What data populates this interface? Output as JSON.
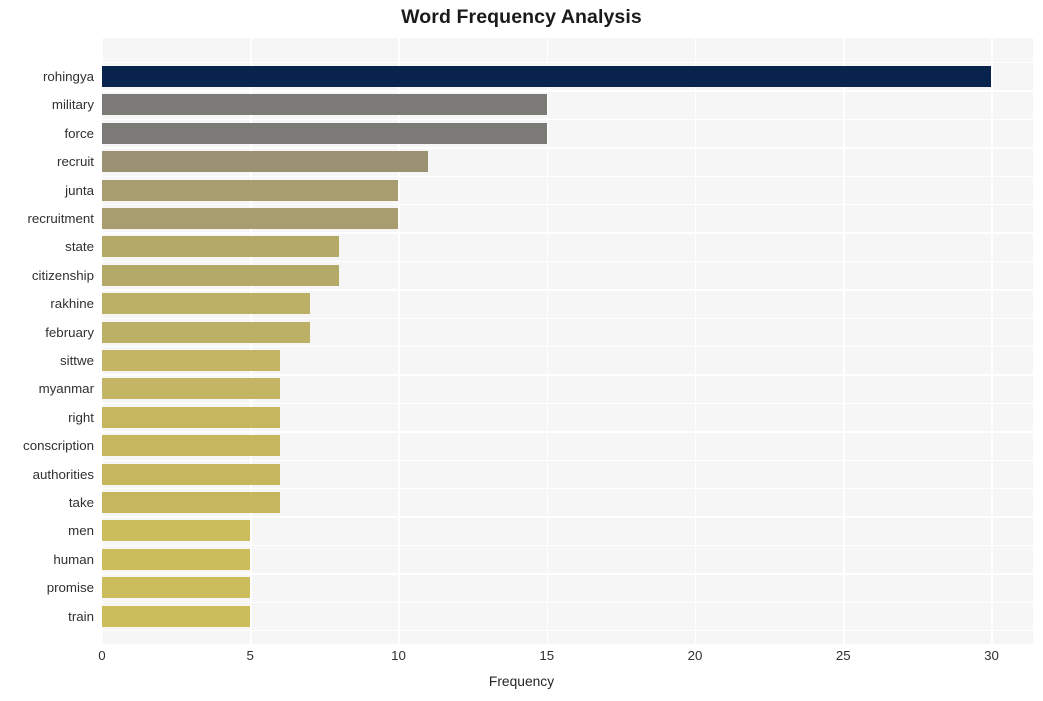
{
  "chart_data": {
    "type": "bar",
    "orientation": "horizontal",
    "title": "Word Frequency Analysis",
    "xlabel": "Frequency",
    "ylabel": "",
    "xlim": [
      0,
      31.4
    ],
    "xticks": [
      0,
      5,
      10,
      15,
      20,
      25,
      30
    ],
    "xtick_labels": [
      "0",
      "5",
      "10",
      "15",
      "20",
      "25",
      "30"
    ],
    "grid": true,
    "grid_color": "#ffffff",
    "plot_background": "#f6f6f7",
    "legend": null,
    "categories": [
      "rohingya",
      "military",
      "force",
      "recruit",
      "junta",
      "recruitment",
      "state",
      "citizenship",
      "rakhine",
      "february",
      "sittwe",
      "myanmar",
      "right",
      "conscription",
      "authorities",
      "take",
      "men",
      "human",
      "promise",
      "train"
    ],
    "values": [
      30,
      15,
      15,
      11,
      10,
      10,
      8,
      8,
      7,
      7,
      6,
      6,
      6,
      6,
      6,
      6,
      5,
      5,
      5,
      5
    ],
    "bar_colors": [
      "#08244d",
      "#7b7a76",
      "#7b7a76",
      "#9b9274",
      "#a89d6e",
      "#a89d6e",
      "#b5a968",
      "#b5a968",
      "#bcaf66",
      "#bcaf66",
      "#c3b563",
      "#c3b563",
      "#c6b75f",
      "#c6b75f",
      "#c6b75f",
      "#c6b75f",
      "#cbbc5c",
      "#cbbc5c",
      "#cbbc5c",
      "#cbbc5c"
    ]
  }
}
